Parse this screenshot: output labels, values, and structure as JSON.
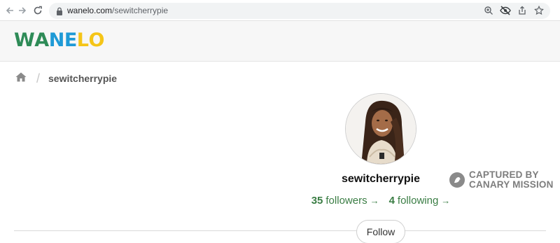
{
  "browser": {
    "url_domain": "wanelo.com",
    "url_path": "/sewitcherrypie",
    "back_icon": "arrow-left-icon",
    "forward_icon": "arrow-right-icon",
    "reload_icon": "reload-icon",
    "lock_icon": "lock-icon",
    "tools": [
      "zoom-icon",
      "eye-off-icon",
      "share-icon",
      "star-icon"
    ]
  },
  "site": {
    "logo": {
      "letters": [
        {
          "char": "W",
          "color": "#2e8b57"
        },
        {
          "char": "A",
          "color": "#2e8b57"
        },
        {
          "char": "N",
          "color": "#1f9ad6"
        },
        {
          "char": "E",
          "color": "#1f9ad6"
        },
        {
          "char": "L",
          "color": "#f5c518"
        },
        {
          "char": "O",
          "color": "#f5c518"
        }
      ]
    }
  },
  "breadcrumb": {
    "home_icon": "home-icon",
    "separator": "/",
    "current": "sewitcherrypie"
  },
  "profile": {
    "username": "sewitcherrypie",
    "followers_count": "35",
    "followers_label": "followers",
    "following_count": "4",
    "following_label": "following",
    "arrow": "→",
    "follow_label": "Follow",
    "link_color": "#3a7d44"
  },
  "watermark": {
    "line1": "CAPTURED BY",
    "line2": "CANARY MISSION",
    "icon": "canary-bird-icon"
  }
}
